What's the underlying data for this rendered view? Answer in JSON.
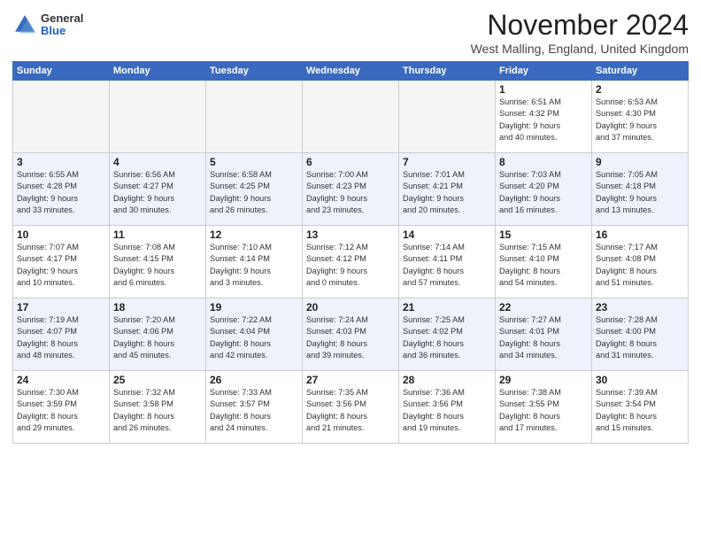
{
  "header": {
    "logo": {
      "general": "General",
      "blue": "Blue"
    },
    "title": "November 2024",
    "location": "West Malling, England, United Kingdom"
  },
  "weekdays": [
    "Sunday",
    "Monday",
    "Tuesday",
    "Wednesday",
    "Thursday",
    "Friday",
    "Saturday"
  ],
  "weeks": [
    [
      {
        "day": "",
        "info": ""
      },
      {
        "day": "",
        "info": ""
      },
      {
        "day": "",
        "info": ""
      },
      {
        "day": "",
        "info": ""
      },
      {
        "day": "",
        "info": ""
      },
      {
        "day": "1",
        "info": "Sunrise: 6:51 AM\nSunset: 4:32 PM\nDaylight: 9 hours\nand 40 minutes."
      },
      {
        "day": "2",
        "info": "Sunrise: 6:53 AM\nSunset: 4:30 PM\nDaylight: 9 hours\nand 37 minutes."
      }
    ],
    [
      {
        "day": "3",
        "info": "Sunrise: 6:55 AM\nSunset: 4:28 PM\nDaylight: 9 hours\nand 33 minutes."
      },
      {
        "day": "4",
        "info": "Sunrise: 6:56 AM\nSunset: 4:27 PM\nDaylight: 9 hours\nand 30 minutes."
      },
      {
        "day": "5",
        "info": "Sunrise: 6:58 AM\nSunset: 4:25 PM\nDaylight: 9 hours\nand 26 minutes."
      },
      {
        "day": "6",
        "info": "Sunrise: 7:00 AM\nSunset: 4:23 PM\nDaylight: 9 hours\nand 23 minutes."
      },
      {
        "day": "7",
        "info": "Sunrise: 7:01 AM\nSunset: 4:21 PM\nDaylight: 9 hours\nand 20 minutes."
      },
      {
        "day": "8",
        "info": "Sunrise: 7:03 AM\nSunset: 4:20 PM\nDaylight: 9 hours\nand 16 minutes."
      },
      {
        "day": "9",
        "info": "Sunrise: 7:05 AM\nSunset: 4:18 PM\nDaylight: 9 hours\nand 13 minutes."
      }
    ],
    [
      {
        "day": "10",
        "info": "Sunrise: 7:07 AM\nSunset: 4:17 PM\nDaylight: 9 hours\nand 10 minutes."
      },
      {
        "day": "11",
        "info": "Sunrise: 7:08 AM\nSunset: 4:15 PM\nDaylight: 9 hours\nand 6 minutes."
      },
      {
        "day": "12",
        "info": "Sunrise: 7:10 AM\nSunset: 4:14 PM\nDaylight: 9 hours\nand 3 minutes."
      },
      {
        "day": "13",
        "info": "Sunrise: 7:12 AM\nSunset: 4:12 PM\nDaylight: 9 hours\nand 0 minutes."
      },
      {
        "day": "14",
        "info": "Sunrise: 7:14 AM\nSunset: 4:11 PM\nDaylight: 8 hours\nand 57 minutes."
      },
      {
        "day": "15",
        "info": "Sunrise: 7:15 AM\nSunset: 4:10 PM\nDaylight: 8 hours\nand 54 minutes."
      },
      {
        "day": "16",
        "info": "Sunrise: 7:17 AM\nSunset: 4:08 PM\nDaylight: 8 hours\nand 51 minutes."
      }
    ],
    [
      {
        "day": "17",
        "info": "Sunrise: 7:19 AM\nSunset: 4:07 PM\nDaylight: 8 hours\nand 48 minutes."
      },
      {
        "day": "18",
        "info": "Sunrise: 7:20 AM\nSunset: 4:06 PM\nDaylight: 8 hours\nand 45 minutes."
      },
      {
        "day": "19",
        "info": "Sunrise: 7:22 AM\nSunset: 4:04 PM\nDaylight: 8 hours\nand 42 minutes."
      },
      {
        "day": "20",
        "info": "Sunrise: 7:24 AM\nSunset: 4:03 PM\nDaylight: 8 hours\nand 39 minutes."
      },
      {
        "day": "21",
        "info": "Sunrise: 7:25 AM\nSunset: 4:02 PM\nDaylight: 8 hours\nand 36 minutes."
      },
      {
        "day": "22",
        "info": "Sunrise: 7:27 AM\nSunset: 4:01 PM\nDaylight: 8 hours\nand 34 minutes."
      },
      {
        "day": "23",
        "info": "Sunrise: 7:28 AM\nSunset: 4:00 PM\nDaylight: 8 hours\nand 31 minutes."
      }
    ],
    [
      {
        "day": "24",
        "info": "Sunrise: 7:30 AM\nSunset: 3:59 PM\nDaylight: 8 hours\nand 29 minutes."
      },
      {
        "day": "25",
        "info": "Sunrise: 7:32 AM\nSunset: 3:58 PM\nDaylight: 8 hours\nand 26 minutes."
      },
      {
        "day": "26",
        "info": "Sunrise: 7:33 AM\nSunset: 3:57 PM\nDaylight: 8 hours\nand 24 minutes."
      },
      {
        "day": "27",
        "info": "Sunrise: 7:35 AM\nSunset: 3:56 PM\nDaylight: 8 hours\nand 21 minutes."
      },
      {
        "day": "28",
        "info": "Sunrise: 7:36 AM\nSunset: 3:56 PM\nDaylight: 8 hours\nand 19 minutes."
      },
      {
        "day": "29",
        "info": "Sunrise: 7:38 AM\nSunset: 3:55 PM\nDaylight: 8 hours\nand 17 minutes."
      },
      {
        "day": "30",
        "info": "Sunrise: 7:39 AM\nSunset: 3:54 PM\nDaylight: 8 hours\nand 15 minutes."
      }
    ]
  ]
}
